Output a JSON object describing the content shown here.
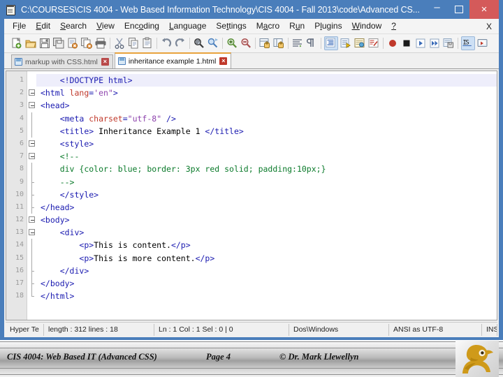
{
  "window": {
    "title": "C:\\COURSES\\CIS 4004 - Web Based Information Technology\\CIS 4004 - Fall 2013\\code\\Advanced CS...",
    "minimize_label": "–",
    "maximize_label": "",
    "close_label": "×"
  },
  "menu": {
    "items": [
      {
        "pre": "F",
        "acc": "i",
        "post": "le"
      },
      {
        "pre": "",
        "acc": "E",
        "post": "dit"
      },
      {
        "pre": "",
        "acc": "S",
        "post": "earch"
      },
      {
        "pre": "",
        "acc": "V",
        "post": "iew"
      },
      {
        "pre": "Enc",
        "acc": "o",
        "post": "ding"
      },
      {
        "pre": "",
        "acc": "L",
        "post": "anguage"
      },
      {
        "pre": "Se",
        "acc": "t",
        "post": "tings"
      },
      {
        "pre": "M",
        "acc": "a",
        "post": "cro"
      },
      {
        "pre": "R",
        "acc": "u",
        "post": "n"
      },
      {
        "pre": "P",
        "acc": "l",
        "post": "ugins"
      },
      {
        "pre": "",
        "acc": "W",
        "post": "indow"
      },
      {
        "pre": "",
        "acc": "?",
        "post": ""
      }
    ],
    "close_document_label": "X"
  },
  "toolbar": {
    "icons": [
      "new-file-icon",
      "open-file-icon",
      "save-icon",
      "save-all-icon",
      "close-file-icon",
      "close-all-icon",
      "print-icon",
      "cut-icon",
      "copy-icon",
      "paste-icon",
      "undo-icon",
      "redo-icon",
      "find-icon",
      "replace-icon",
      "zoom-in-icon",
      "zoom-out-icon",
      "sync-vertical-icon",
      "sync-horizontal-icon",
      "word-wrap-icon",
      "show-all-characters-icon",
      "indent-guide-icon",
      "show-symbol-icon",
      "user-defined-dialog-icon",
      "document-map-icon",
      "record-macro-icon",
      "stop-record-icon",
      "play-macro-icon",
      "run-macro-multiple-icon",
      "save-macro-icon",
      "text-direction-icon",
      "run-file-icon"
    ]
  },
  "tabs": [
    {
      "label": "markup with CSS.html",
      "active": false,
      "close_label": "×"
    },
    {
      "label": "inheritance example 1.html",
      "active": true,
      "close_label": "×"
    }
  ],
  "editor": {
    "line_numbers": [
      1,
      2,
      3,
      4,
      5,
      6,
      7,
      8,
      9,
      10,
      11,
      12,
      13,
      14,
      15,
      16,
      17,
      18
    ],
    "lines": [
      {
        "n": 1,
        "fold": "none",
        "current": true,
        "tokens": [
          {
            "t": "tx",
            "v": "    "
          },
          {
            "t": "tg",
            "v": "<!DOCTYPE html>"
          }
        ]
      },
      {
        "n": 2,
        "fold": "open",
        "current": false,
        "tokens": [
          {
            "t": "tg",
            "v": "<html "
          },
          {
            "t": "at",
            "v": "lang"
          },
          {
            "t": "tg",
            "v": "="
          },
          {
            "t": "av",
            "v": "'en\""
          },
          {
            "t": "tg",
            "v": ">"
          }
        ]
      },
      {
        "n": 3,
        "fold": "open",
        "current": false,
        "tokens": [
          {
            "t": "tg",
            "v": "<head>"
          }
        ]
      },
      {
        "n": 4,
        "fold": "line",
        "current": false,
        "tokens": [
          {
            "t": "tx",
            "v": "    "
          },
          {
            "t": "tg",
            "v": "<meta "
          },
          {
            "t": "at",
            "v": "charset"
          },
          {
            "t": "tg",
            "v": "="
          },
          {
            "t": "av",
            "v": "\"utf-8\""
          },
          {
            "t": "tg",
            "v": " />"
          }
        ]
      },
      {
        "n": 5,
        "fold": "line",
        "current": false,
        "tokens": [
          {
            "t": "tx",
            "v": "    "
          },
          {
            "t": "tg",
            "v": "<title>"
          },
          {
            "t": "tx",
            "v": " Inheritance Example 1 "
          },
          {
            "t": "tg",
            "v": "</title>"
          }
        ]
      },
      {
        "n": 6,
        "fold": "open",
        "current": false,
        "tokens": [
          {
            "t": "tx",
            "v": "    "
          },
          {
            "t": "tg",
            "v": "<style>"
          }
        ]
      },
      {
        "n": 7,
        "fold": "open",
        "current": false,
        "tokens": [
          {
            "t": "tx",
            "v": "    "
          },
          {
            "t": "cm",
            "v": "<!--"
          }
        ]
      },
      {
        "n": 8,
        "fold": "line",
        "current": false,
        "tokens": [
          {
            "t": "tx",
            "v": "    "
          },
          {
            "t": "cm",
            "v": "div {color: blue; border: 3px red solid; padding:10px;}"
          }
        ]
      },
      {
        "n": 9,
        "fold": "tick",
        "current": false,
        "tokens": [
          {
            "t": "tx",
            "v": "    "
          },
          {
            "t": "cm",
            "v": "-->"
          }
        ]
      },
      {
        "n": 10,
        "fold": "tick",
        "current": false,
        "tokens": [
          {
            "t": "tx",
            "v": "    "
          },
          {
            "t": "tg",
            "v": "</style>"
          }
        ]
      },
      {
        "n": 11,
        "fold": "tick",
        "current": false,
        "tokens": [
          {
            "t": "tg",
            "v": "</head>"
          }
        ]
      },
      {
        "n": 12,
        "fold": "open",
        "current": false,
        "tokens": [
          {
            "t": "tg",
            "v": "<body>"
          }
        ]
      },
      {
        "n": 13,
        "fold": "open",
        "current": false,
        "tokens": [
          {
            "t": "tx",
            "v": "    "
          },
          {
            "t": "tg",
            "v": "<div>"
          }
        ]
      },
      {
        "n": 14,
        "fold": "line",
        "current": false,
        "tokens": [
          {
            "t": "tx",
            "v": "        "
          },
          {
            "t": "tg",
            "v": "<p>"
          },
          {
            "t": "tx",
            "v": "This is content."
          },
          {
            "t": "tg",
            "v": "</p>"
          }
        ]
      },
      {
        "n": 15,
        "fold": "line",
        "current": false,
        "tokens": [
          {
            "t": "tx",
            "v": "        "
          },
          {
            "t": "tg",
            "v": "<p>"
          },
          {
            "t": "tx",
            "v": "This is more content."
          },
          {
            "t": "tg",
            "v": "</p>"
          }
        ]
      },
      {
        "n": 16,
        "fold": "tick",
        "current": false,
        "tokens": [
          {
            "t": "tx",
            "v": "    "
          },
          {
            "t": "tg",
            "v": "</div>"
          }
        ]
      },
      {
        "n": 17,
        "fold": "tick",
        "current": false,
        "tokens": [
          {
            "t": "tg",
            "v": "</body>"
          }
        ]
      },
      {
        "n": 18,
        "fold": "end",
        "current": false,
        "tokens": [
          {
            "t": "tg",
            "v": "</html>"
          }
        ]
      }
    ]
  },
  "statusbar": {
    "language": "Hyper Te",
    "length_lines": "length : 312   lines : 18",
    "caret": "Ln : 1   Col : 1   Sel : 0 | 0",
    "eol": "Dos\\Windows",
    "encoding": "ANSI as UTF-8",
    "insert_mode": "INS"
  },
  "footer": {
    "course": "CIS 4004: Web Based IT (Advanced CSS)",
    "page": "Page 4",
    "copyright": "© Dr. Mark Llewellyn",
    "logo_name": "ucf-pegasus-logo"
  },
  "colors": {
    "title_bar": "#4a7ebb",
    "close_button": "#d45a5a",
    "tag": "#1a1ab0",
    "attribute": "#c0392b",
    "value": "#8e44ad",
    "comment": "#0a7a2a",
    "active_tab_top": "#e8a33d",
    "logo_gold": "#cf9a1a"
  }
}
